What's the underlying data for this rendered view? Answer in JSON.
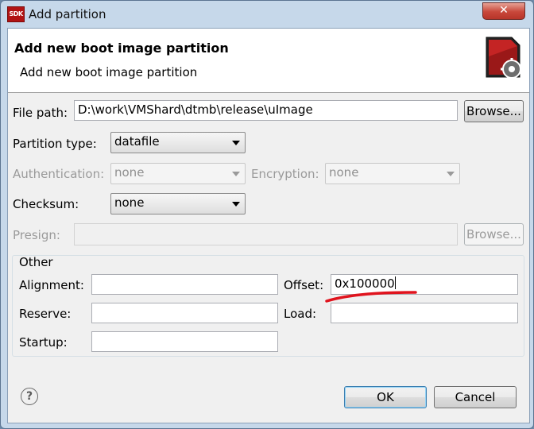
{
  "window": {
    "title": "Add partition",
    "app_icon_text": "SDK",
    "close_glyph": "✕"
  },
  "banner": {
    "title": "Add new boot image partition",
    "message": "Add new boot image partition",
    "icon": "sd-card-gear-icon"
  },
  "file_path": {
    "label": "File path:",
    "value": "D:\\work\\VMShard\\dtmb\\release\\uImage",
    "browse_label": "Browse..."
  },
  "partition_type": {
    "label": "Partition type:",
    "value": "datafile"
  },
  "authentication": {
    "label": "Authentication:",
    "value": "none"
  },
  "encryption": {
    "label": "Encryption:",
    "value": "none"
  },
  "checksum": {
    "label": "Checksum:",
    "value": "none"
  },
  "presign": {
    "label": "Presign:",
    "value": "",
    "browse_label": "Browse..."
  },
  "other": {
    "group_label": "Other",
    "alignment": {
      "label": "Alignment:",
      "value": ""
    },
    "offset": {
      "label": "Offset:",
      "value": "0x100000"
    },
    "reserve": {
      "label": "Reserve:",
      "value": ""
    },
    "load": {
      "label": "Load:",
      "value": ""
    },
    "startup": {
      "label": "Startup:",
      "value": ""
    }
  },
  "buttons": {
    "ok": "OK",
    "cancel": "Cancel",
    "help": "?"
  },
  "annotation": {
    "color": "#e0141e"
  }
}
